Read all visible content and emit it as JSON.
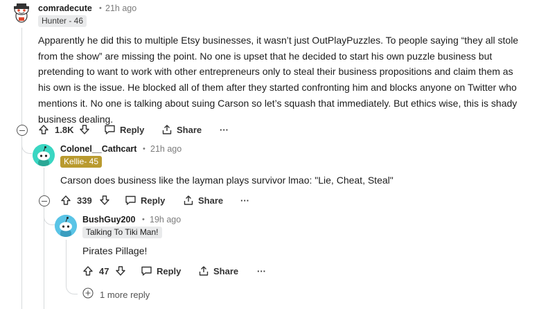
{
  "comments": [
    {
      "username": "comradecute",
      "time": "21h ago",
      "flair": "Hunter - 46",
      "flair_bg": "#e9eaeb",
      "flair_color": "#3a3a3a",
      "body": "Apparently he did this to multiple Etsy businesses, it wasn’t just OutPlayPuzzles. To people saying “they all stole from the show” are missing the point. No one is upset that he decided to start his own puzzle business but pretending to want to work with other entrepreneurs only to steal their business propositions and claim them as his own is the issue. He blocked all of them after they started confronting him and blocks anyone on Twitter who mentions it. No one is talking about suing Carson so let’s squash that immediately. But ethics wise, this is shady business dealing.",
      "votes": "1.8K",
      "reply_label": "Reply",
      "share_label": "Share",
      "more_label": "···"
    },
    {
      "username": "Colonel__Cathcart",
      "time": "21h ago",
      "flair": "Kellie- 45",
      "flair_bg": "#b99a2e",
      "flair_color": "#ffffff",
      "body": "Carson does business like the layman plays survivor lmao: \"Lie, Cheat, Steal\"",
      "votes": "339",
      "reply_label": "Reply",
      "share_label": "Share",
      "more_label": "···"
    },
    {
      "username": "BushGuy200",
      "time": "19h ago",
      "flair": "Talking To Tiki Man!",
      "flair_bg": "#e9eaeb",
      "flair_color": "#1c1c1c",
      "body": "Pirates Pillage!",
      "votes": "47",
      "reply_label": "Reply",
      "share_label": "Share",
      "more_label": "···"
    }
  ],
  "more_replies": "1 more reply",
  "separator": "•",
  "colors": {
    "thread_line": "#d7dadc",
    "meta_gray": "#7c7c7c",
    "avatar_teal": "#3ad6c2",
    "avatar_blue": "#5ac4e6"
  }
}
